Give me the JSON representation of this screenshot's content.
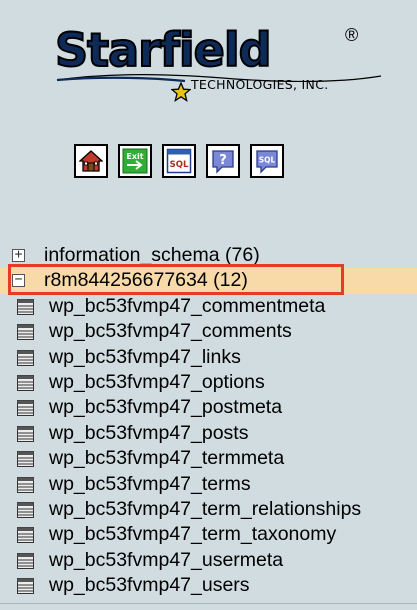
{
  "logo": {
    "wordmark": "Starfield",
    "registered": "®",
    "tagline": "TECHNOLOGIES, INC."
  },
  "toolbar": {
    "buttons": [
      {
        "name": "home",
        "icon": "home-icon"
      },
      {
        "name": "exit",
        "icon": "exit-icon",
        "text": "Exit"
      },
      {
        "name": "sql",
        "icon": "sql-query-icon",
        "text": "SQL"
      },
      {
        "name": "help",
        "icon": "help-icon",
        "text": "?"
      },
      {
        "name": "sql-docs",
        "icon": "sql-docs-icon",
        "text": "SQL"
      }
    ]
  },
  "tree": {
    "databases": [
      {
        "name": "information_schema",
        "count": "(76)",
        "expanded": false,
        "toggle": "+"
      },
      {
        "name": "r8m844256677634",
        "count": "(12)",
        "expanded": true,
        "toggle": "−",
        "selected": true
      }
    ],
    "tables": [
      "wp_bc53fvmp47_commentmeta",
      "wp_bc53fvmp47_comments",
      "wp_bc53fvmp47_links",
      "wp_bc53fvmp47_options",
      "wp_bc53fvmp47_postmeta",
      "wp_bc53fvmp47_posts",
      "wp_bc53fvmp47_termmeta",
      "wp_bc53fvmp47_terms",
      "wp_bc53fvmp47_term_relationships",
      "wp_bc53fvmp47_term_taxonomy",
      "wp_bc53fvmp47_usermeta",
      "wp_bc53fvmp47_users"
    ]
  },
  "colors": {
    "background": "#D0DCE0",
    "selected_row": "#F8D9A8",
    "highlight_border": "#E83A26",
    "logo_navy": "#0E2A58"
  }
}
